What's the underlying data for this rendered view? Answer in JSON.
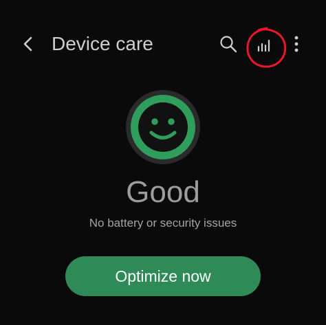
{
  "header": {
    "title": "Device care",
    "back_icon": "back-arrow-icon",
    "search_icon": "search-icon",
    "stats_icon": "bar-chart-icon",
    "more_icon": "more-vertical-icon"
  },
  "status": {
    "icon": "smiley-face-icon",
    "label": "Good",
    "subtitle": "No battery or security issues"
  },
  "actions": {
    "optimize_label": "Optimize now"
  },
  "colors": {
    "accent_green": "#2e8b58",
    "face_green": "#2f9e5c",
    "annotation_red": "#e8182b",
    "background": "#0a0a0a"
  }
}
